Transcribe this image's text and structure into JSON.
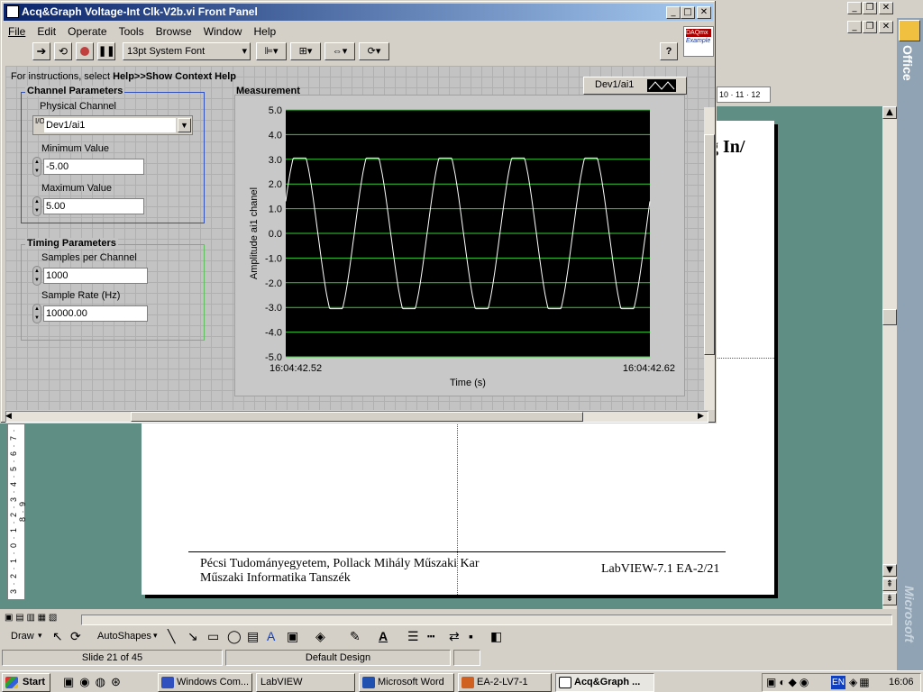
{
  "ppt": {
    "ruler_marks": "10 · 11 · 12",
    "slide_heading_fragment": "g In/",
    "footer_left_line1": "Pécsi Tudományegyetem, Pollack Mihály Műszaki Kar",
    "footer_left_line2": "Műszaki Informatika Tanszék",
    "footer_right": "LabVIEW-7.1 EA-2/21",
    "vruler_marks": "3 · 2 · 1 · 0 · 1 · 2 · 3 · 4 · 5 · 6 · 7 · 8 · 9",
    "drawbar": {
      "draw_label": "Draw",
      "autoshapes_label": "AutoShapes"
    },
    "statusbar": {
      "slide_info": "Slide 21 of 45",
      "design": "Default Design"
    },
    "office_bar_label": "Office",
    "microsoft_label": "Microsoft"
  },
  "labview": {
    "title": "Acq&Graph Voltage-Int Clk-V2b.vi Front Panel",
    "menu": [
      "File",
      "Edit",
      "Operate",
      "Tools",
      "Browse",
      "Window",
      "Help"
    ],
    "font_select": "13pt System Font",
    "badge_line1": "DAQmx",
    "badge_line2": "Example",
    "instructions_prefix": "For instructions, select ",
    "instructions_bold": "Help>>Show Context Help",
    "channel_params": {
      "title": "Channel Parameters",
      "physical_channel_label": "Physical Channel",
      "physical_channel_value": "Dev1/ai1",
      "min_label": "Minimum Value",
      "min_value": "-5.00",
      "max_label": "Maximum Value",
      "max_value": "5.00"
    },
    "timing_params": {
      "title": "Timing Parameters",
      "samples_label": "Samples per Channel",
      "samples_value": "1000",
      "rate_label": "Sample Rate (Hz)",
      "rate_value": "10000.00"
    },
    "measurement_label": "Measurement",
    "legend_label": "Dev1/ai1"
  },
  "chart_data": {
    "type": "line",
    "title": "Measurement",
    "xlabel": "Time (s)",
    "ylabel": "Amplitude ai1 chanel",
    "xlim_labels": [
      "16:04:42.52",
      "16:04:42.62"
    ],
    "xlim": [
      0,
      0.1
    ],
    "ylim": [
      -5,
      5
    ],
    "yticks": [
      "5.0",
      "4.0",
      "3.0",
      "2.0",
      "1.0",
      "0.0",
      "-1.0",
      "-2.0",
      "-3.0",
      "-4.0",
      "-5.0"
    ],
    "grid": true,
    "legend_placement": "top-right",
    "series": [
      {
        "name": "Dev1/ai1",
        "description_of_shape": "clipped sine wave, amplitude ±3.05 V, 5 periods over 0.1 s (50 Hz)",
        "amplitude": 3.05,
        "frequency_hz": 50,
        "phase_note": "starts near +1.3 V rising",
        "color": "#ffffff"
      }
    ],
    "grid_color": "#33cc33",
    "background_color": "#000000"
  },
  "taskbar": {
    "start": "Start",
    "tasks": [
      "Windows Com...",
      "LabVIEW",
      "Microsoft Word",
      "EA-2-LV7-1",
      "Acq&Graph ..."
    ],
    "tray_lang": "EN",
    "clock": "16:06"
  }
}
